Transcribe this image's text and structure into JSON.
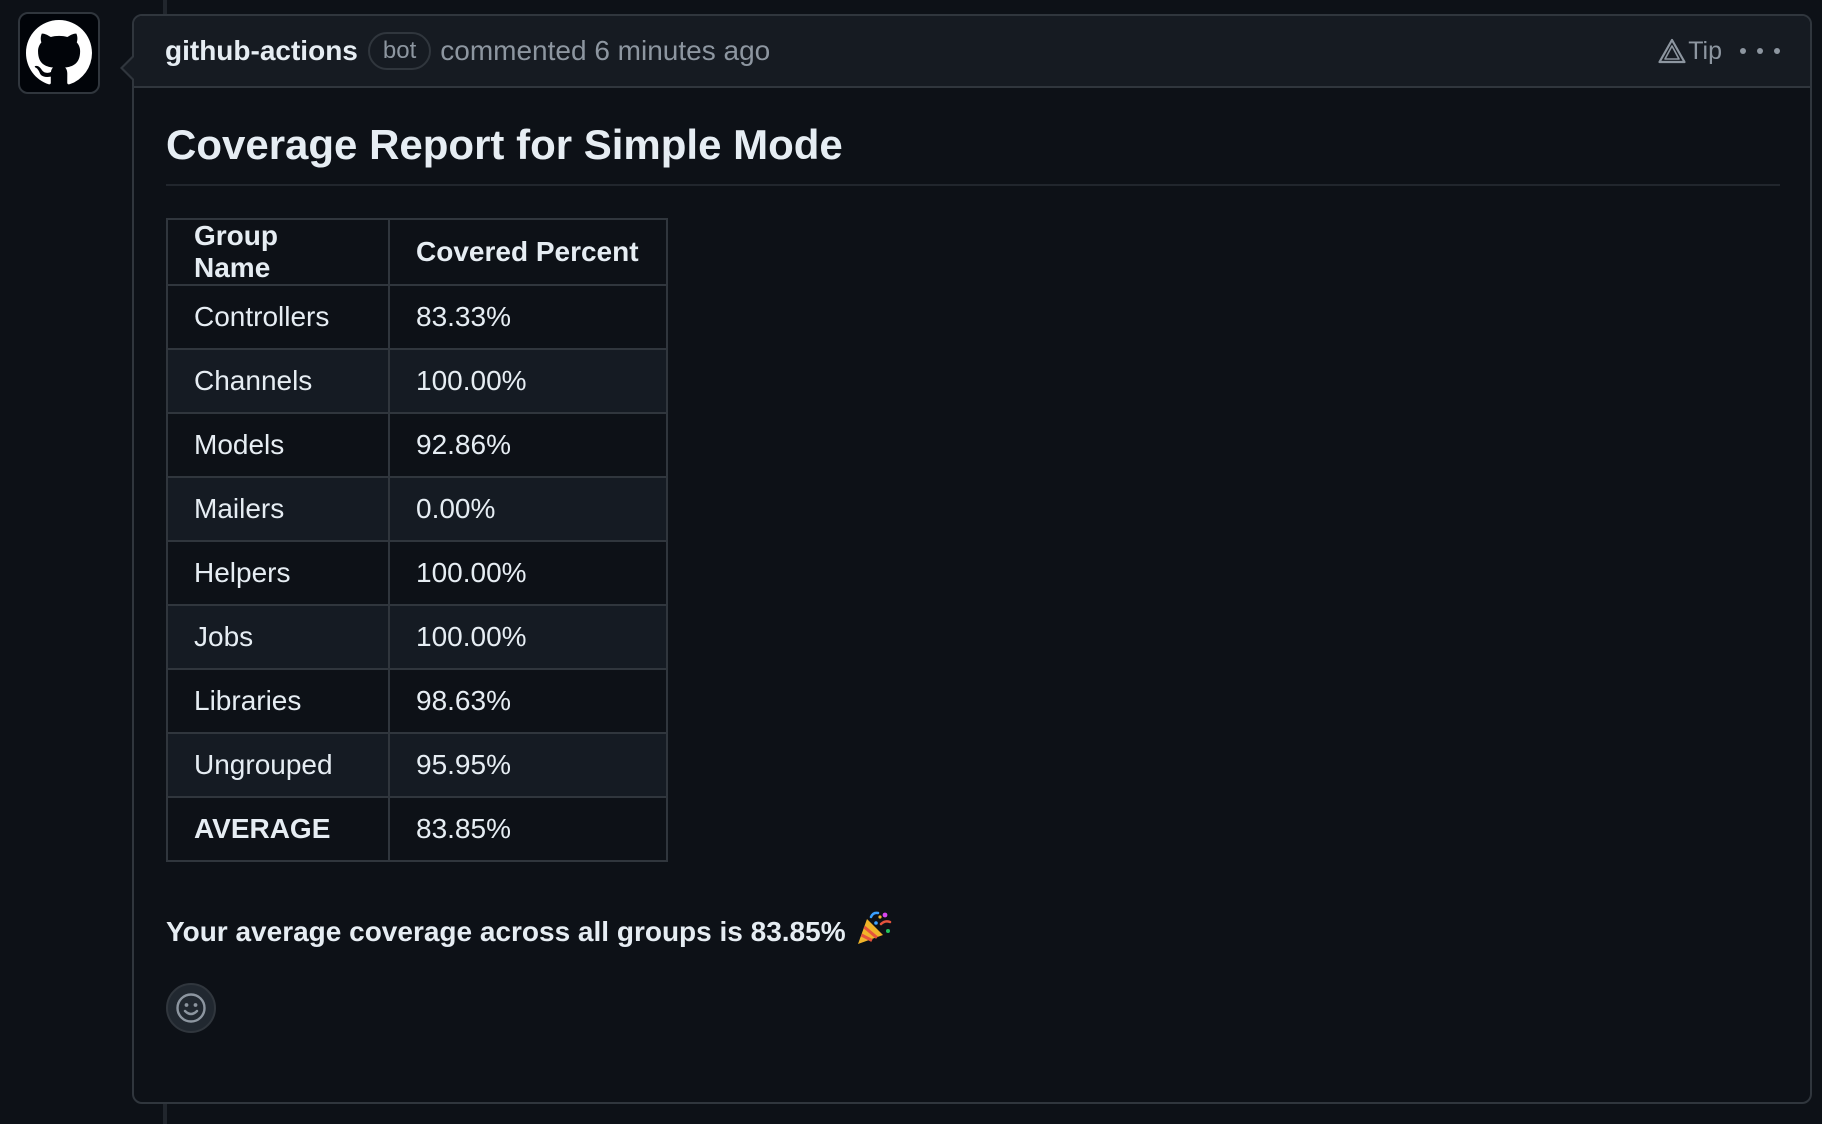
{
  "comment": {
    "author": "github-actions",
    "badge": "bot",
    "action": "commented 6 minutes ago",
    "tip_label": "Tip"
  },
  "report": {
    "title": "Coverage Report for Simple Mode",
    "columns": [
      "Group Name",
      "Covered Percent"
    ],
    "rows": [
      [
        "Controllers",
        "83.33%"
      ],
      [
        "Channels",
        "100.00%"
      ],
      [
        "Models",
        "92.86%"
      ],
      [
        "Mailers",
        "0.00%"
      ],
      [
        "Helpers",
        "100.00%"
      ],
      [
        "Jobs",
        "100.00%"
      ],
      [
        "Libraries",
        "98.63%"
      ],
      [
        "Ungrouped",
        "95.95%"
      ],
      [
        "AVERAGE",
        "83.85%"
      ]
    ],
    "summary": "Your average coverage across all groups is 83.85%"
  },
  "icons": {
    "avatar": "github-octocat-icon",
    "tip": "alert-triangle-icon",
    "more": "kebab-horizontal-icon",
    "summary_emoji": "party-popper-icon",
    "reaction": "smiley-icon"
  }
}
